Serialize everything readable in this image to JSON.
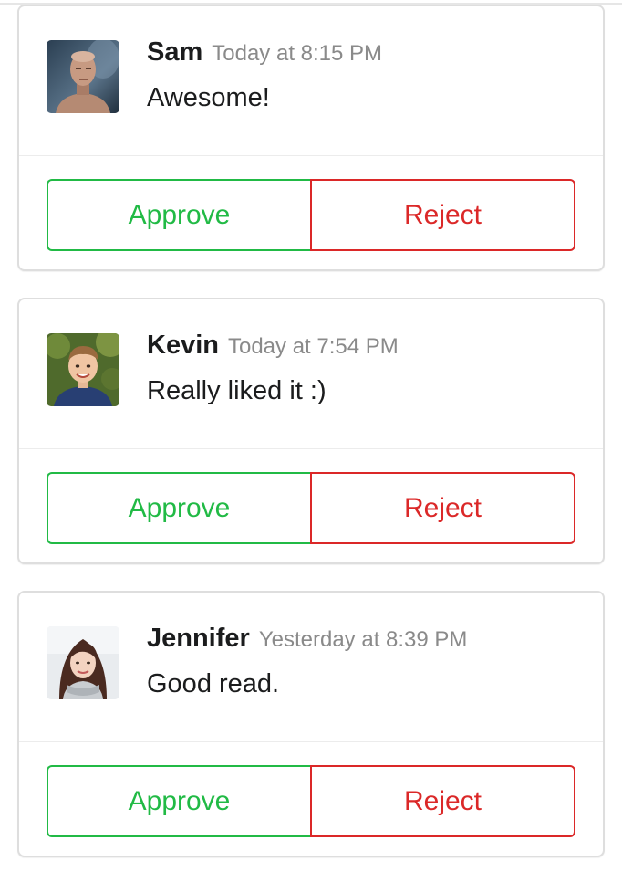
{
  "colors": {
    "approve": "#21ba45",
    "reject": "#db2828"
  },
  "comments": [
    {
      "author": "Sam",
      "date": "Today at 8:15 PM",
      "text": "Awesome!",
      "avatar": "man-avatar",
      "approve_label": "Approve",
      "reject_label": "Reject"
    },
    {
      "author": "Kevin",
      "date": "Today at 7:54 PM",
      "text": "Really liked it :)",
      "avatar": "boy-avatar",
      "approve_label": "Approve",
      "reject_label": "Reject"
    },
    {
      "author": "Jennifer",
      "date": "Yesterday at 8:39 PM",
      "text": "Good read.",
      "avatar": "woman-avatar",
      "approve_label": "Approve",
      "reject_label": "Reject"
    }
  ]
}
